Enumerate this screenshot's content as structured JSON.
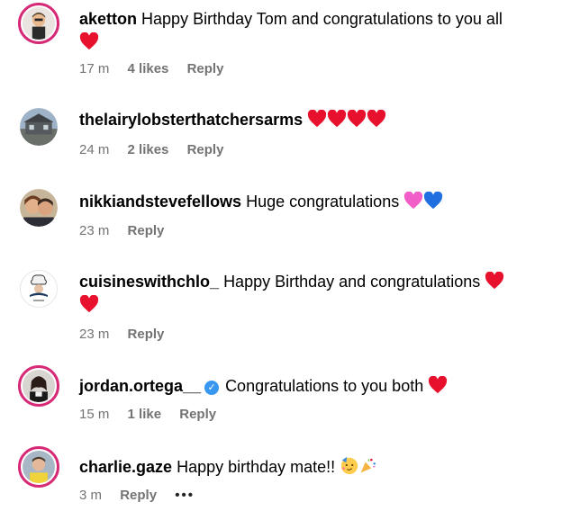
{
  "comments": [
    {
      "username": "aketton",
      "text": "Happy Birthday Tom and congratulations to you all",
      "emojis": [
        "red-heart"
      ],
      "time": "17 m",
      "likes": "4 likes",
      "reply": "Reply",
      "avatar_icon": "bitmoji-avatar",
      "story_ring": true,
      "verified": false
    },
    {
      "username": "thelairylobsterthatchersarms",
      "text": "",
      "emojis": [
        "red-heart",
        "red-heart",
        "red-heart",
        "red-heart"
      ],
      "time": "24 m",
      "likes": "2 likes",
      "reply": "Reply",
      "avatar_icon": "pub-building-avatar",
      "story_ring": false,
      "verified": false
    },
    {
      "username": "nikkiandstevefellows",
      "text": "Huge congratulations",
      "emojis": [
        "pink-heart",
        "blue-heart"
      ],
      "time": "23 m",
      "likes": "",
      "reply": "Reply",
      "avatar_icon": "couple-photo-avatar",
      "story_ring": false,
      "verified": false
    },
    {
      "username": "cuisineswithchlo_",
      "text": "Happy Birthday and congratulations",
      "emojis": [
        "red-heart",
        "red-heart"
      ],
      "time": "23 m",
      "likes": "",
      "reply": "Reply",
      "avatar_icon": "chef-logo-avatar",
      "story_ring": false,
      "verified": false
    },
    {
      "username": "jordan.ortega__",
      "text": "Congratulations to you both",
      "emojis": [
        "red-heart"
      ],
      "time": "15 m",
      "likes": "1 like",
      "reply": "Reply",
      "avatar_icon": "person-photo-avatar",
      "story_ring": true,
      "verified": true
    },
    {
      "username": "charlie.gaze",
      "text": "Happy birthday mate!!",
      "emojis": [
        "partying-face",
        "party-popper"
      ],
      "time": "3 m",
      "likes": "",
      "reply": "Reply",
      "more": "•••",
      "avatar_icon": "selfie-photo-avatar",
      "story_ring": true,
      "verified": false
    }
  ],
  "colors": {
    "story_ring": "#d62976",
    "meta_text": "#737373",
    "verified": "#3897f0",
    "red_heart": "#e8112d",
    "pink_heart": "#f25ec8",
    "blue_heart": "#1f6fe0"
  }
}
